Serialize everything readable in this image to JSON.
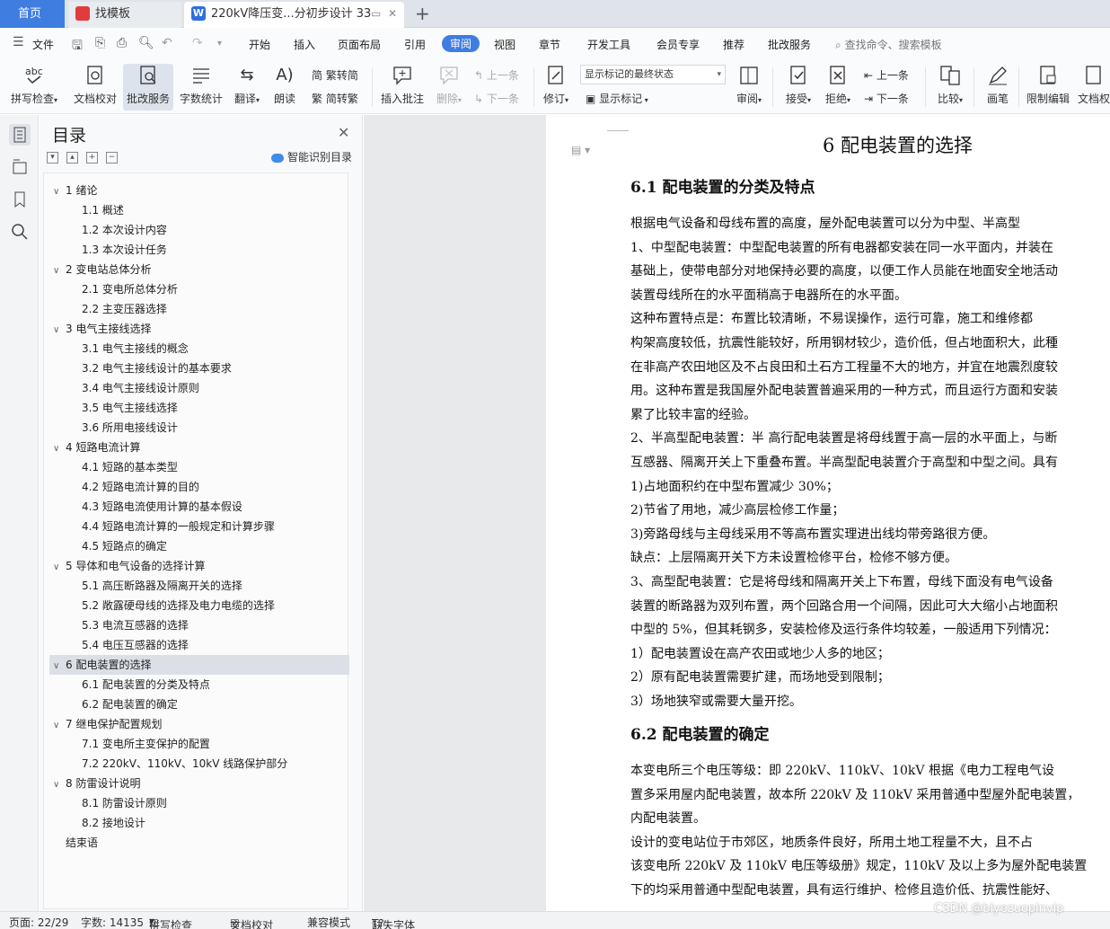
{
  "tabs": {
    "home": "首页",
    "tab1": "找模板",
    "tab2": "220kV降压变...分初步设计 33"
  },
  "menu": {
    "file": "文件",
    "items": [
      "开始",
      "插入",
      "页面布局",
      "引用",
      "审阅",
      "视图",
      "章节",
      "开发工具",
      "会员专享",
      "推荐",
      "批改服务"
    ],
    "active": "审阅",
    "search_placeholder": "查找命令、搜索模板"
  },
  "ribbon": {
    "spellcheck": "拼写检查",
    "doccheck": "文档校对",
    "correction": "批改服务",
    "wordcount": "字数统计",
    "translate": "翻译",
    "read": "朗读",
    "trad_to_simp": "繁转简",
    "simp_to_trad": "简转繁",
    "insert_comment": "插入批注",
    "delete": "删除",
    "prev1": "上一条",
    "next1": "下一条",
    "revise": "修订",
    "markup_state": "显示标记的最终状态",
    "show_markup": "显示标记",
    "review": "审阅",
    "accept": "接受",
    "reject": "拒绝",
    "prev2": "上一条",
    "next2": "下一条",
    "compare": "比较",
    "pen": "画笔",
    "restrict": "限制编辑",
    "doc_perm": "文档权"
  },
  "toc": {
    "title": "目录",
    "smart": "智能识别目录",
    "items": [
      {
        "text": "1  绪论",
        "level": 1
      },
      {
        "text": "1.1   概述",
        "level": 2
      },
      {
        "text": "1.2   本次设计内容",
        "level": 2
      },
      {
        "text": "1.3   本次设计任务",
        "level": 2
      },
      {
        "text": "2 变电站总体分析",
        "level": 1
      },
      {
        "text": "2.1   变电所总体分析",
        "level": 2
      },
      {
        "text": "2.2 主变压器选择",
        "level": 2
      },
      {
        "text": "3 电气主接线选择",
        "level": 1
      },
      {
        "text": "3.1 电气主接线的概念",
        "level": 2
      },
      {
        "text": "3.2 电气主接线设计的基本要求",
        "level": 2
      },
      {
        "text": "3.4 电气主接线设计原则",
        "level": 2
      },
      {
        "text": "3.5 电气主接线选择",
        "level": 2
      },
      {
        "text": "3.6 所用电接线设计",
        "level": 2
      },
      {
        "text": "4 短路电流计算",
        "level": 1
      },
      {
        "text": "4.1 短路的基本类型",
        "level": 2
      },
      {
        "text": "4.2 短路电流计算的目的",
        "level": 2
      },
      {
        "text": "4.3 短路电流使用计算的基本假设",
        "level": 2
      },
      {
        "text": "4.4 短路电流计算的一般规定和计算步骤",
        "level": 2
      },
      {
        "text": "4.5 短路点的确定",
        "level": 2
      },
      {
        "text": "5 导体和电气设备的选择计算",
        "level": 1
      },
      {
        "text": "5.1 高压断路器及隔离开关的选择",
        "level": 2
      },
      {
        "text": "5.2 敞露硬母线的选择及电力电缆的选择",
        "level": 2
      },
      {
        "text": "5.3 电流互感器的选择",
        "level": 2
      },
      {
        "text": "5.4 电压互感器的选择",
        "level": 2
      },
      {
        "text": "6 配电装置的选择",
        "level": 1
      },
      {
        "text": "6.1 配电装置的分类及特点",
        "level": 2
      },
      {
        "text": "6.2 配电装置的确定",
        "level": 2
      },
      {
        "text": "7  继电保护配置规划",
        "level": 1
      },
      {
        "text": "7.1 变电所主变保护的配置",
        "level": 2
      },
      {
        "text": "7.2   220kV、110kV、10kV 线路保护部分",
        "level": 2
      },
      {
        "text": "8  防雷设计说明",
        "level": 1
      },
      {
        "text": "8.1 防雷设计原则",
        "level": 2
      },
      {
        "text": "8.2 接地设计",
        "level": 2
      },
      {
        "text": "结束语",
        "level": 0
      }
    ],
    "selected_index": 24
  },
  "document": {
    "h1": "6  配电装置的选择",
    "h2a": "6.1  配电装置的分类及特点",
    "h2b": "6.2  配电装置的确定",
    "lines_a": [
      "    根据电气设备和母线布置的高度，屋外配电装置可以分为中型、半高型",
      "1、中型配电装置：中型配电装置的所有电器都安装在同一水平面内，并装在",
      "基础上，使带电部分对地保持必要的高度，以便工作人员能在地面安全地活动",
      "装置母线所在的水平面稍高于电器所在的水平面。",
      "    这种布置特点是：布置比较清晰，不易误操作，运行可靠，施工和维修都",
      "构架高度较低，抗震性能较好，所用钢材较少，造价低，但占地面积大，此種",
      "在非高产农田地区及不占良田和土石方工程量不大的地方，并宜在地震烈度较",
      "用。这种布置是我国屋外配电装置普遍采用的一种方式，而且运行方面和安装",
      "累了比较丰富的经验。",
      "2、半高型配电装置：半 高行配电装置是将母线置于高一层的水平面上，与断",
      "互感器、隔离开关上下重叠布置。半高型配电装置介于高型和中型之间。具有",
      "    1)占地面积约在中型布置减少 30%；",
      "    2)节省了用地，减少高层检修工作量；",
      "    3)旁路母线与主母线采用不等高布置实理进出线均带旁路很方便。",
      "    缺点：上层隔离开关下方未设置检修平台，检修不够方便。",
      "3、高型配电装置：它是将母线和隔离开关上下布置，母线下面没有电气设备",
      "装置的断路器为双列布置，两个回路合用一个间隔，因此可大大缩小占地面积",
      "中型的 5%，但其耗钢多，安装检修及运行条件均较差，一般适用下列情况：",
      "    1）配电装置设在高产农田或地少人多的地区；",
      "    2）原有配电装置需要扩建，而场地受到限制；",
      "    3）场地狭窄或需要大量开挖。"
    ],
    "lines_b": [
      "    本变电所三个电压等级：即 220kV、110kV、10kV 根据《电力工程电气设",
      "置多采用屋内配电装置，故本所 220kV 及 110kV 采用普通中型屋外配电装置，",
      "内配电装置。",
      "    设计的变电站位于市郊区，地质条件良好，所用土地工程量不大，且不占",
      "该变电所 220kV 及 110kV 电压等级册》规定，110kV 及以上多为屋外配电装置",
      "下的均采用普通中型配电装置，具有运行维护、检修且造价低、抗震性能好、"
    ]
  },
  "status": {
    "page": "页面: 22/29",
    "words": "字数: 14135",
    "spell": "拼写检查",
    "doccheck": "文档校对",
    "compat": "兼容模式",
    "missing_font": "缺失字体"
  },
  "watermark": "CSDN @biyezuopinvip",
  "colors": {
    "accent": "#3f7de0",
    "selected_toc": "#dce0e6"
  }
}
